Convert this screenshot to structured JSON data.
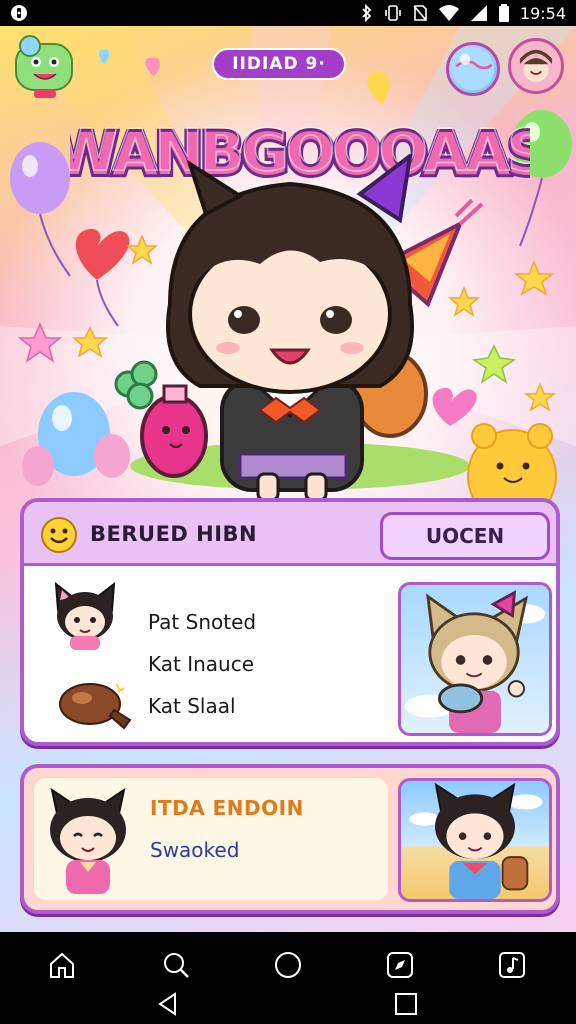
{
  "status_bar": {
    "time": "19:54",
    "icons": [
      "notification-icon",
      "bluetooth-icon",
      "vibrate-icon",
      "no-sim-icon",
      "wifi-icon",
      "signal-icon",
      "battery-icon"
    ]
  },
  "game": {
    "top_pill_label": "IIDIAD 9·",
    "title_text": "WANBGOOOAAS",
    "colors": {
      "accent": "#a23fc8",
      "card_border": "#b05ad0",
      "title_pink": "#f06ab0"
    }
  },
  "card1": {
    "title": "BERUED HIBN",
    "tab_label": "UOCEN",
    "items": [
      {
        "label": "Pat Snoted"
      },
      {
        "label": "Kat Inauce"
      },
      {
        "label": "Kat Slaal"
      }
    ]
  },
  "card2": {
    "title": "ITDA ENDOIN",
    "subtitle": "Swaoked"
  },
  "nav": {
    "top_icons": [
      "home-icon",
      "search-icon",
      "circle-icon",
      "compass-icon",
      "music-icon"
    ],
    "bottom_icons": [
      "back-icon",
      "recents-icon"
    ]
  }
}
